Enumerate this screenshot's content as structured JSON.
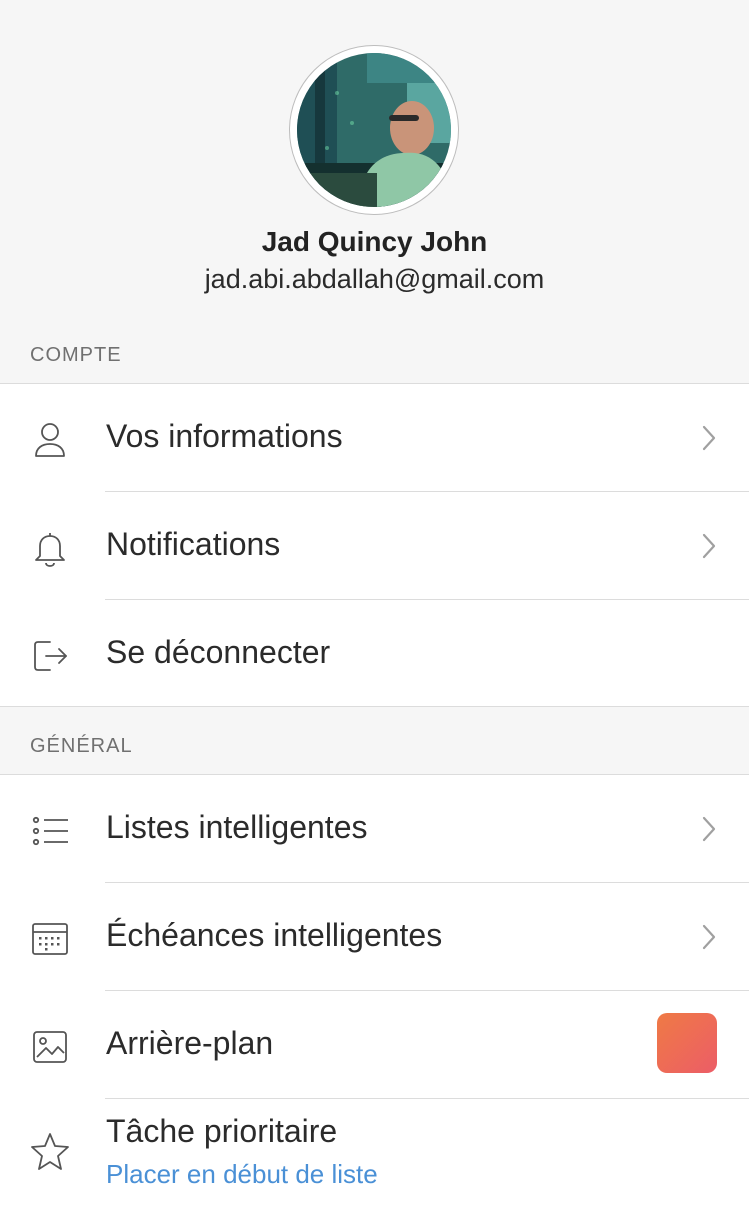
{
  "profile": {
    "name": "Jad Quincy John",
    "email": "jad.abi.abdallah@gmail.com"
  },
  "sections": {
    "compte": {
      "header": "COMPTE",
      "items": [
        {
          "label": "Vos informations",
          "icon": "user-icon",
          "chevron": true
        },
        {
          "label": "Notifications",
          "icon": "bell-icon",
          "chevron": true
        },
        {
          "label": "Se déconnecter",
          "icon": "logout-icon",
          "chevron": false
        }
      ]
    },
    "general": {
      "header": "GÉNÉRAL",
      "items": [
        {
          "label": "Listes intelligentes",
          "icon": "list-icon",
          "chevron": true
        },
        {
          "label": "Échéances intelligentes",
          "icon": "calendar-icon",
          "chevron": true
        },
        {
          "label": "Arrière-plan",
          "icon": "image-icon",
          "swatch_colors": [
            "#ef7a45",
            "#ec5d67"
          ]
        },
        {
          "label": "Tâche prioritaire",
          "sublabel": "Placer en début de liste",
          "icon": "star-icon"
        }
      ]
    }
  },
  "colors": {
    "link": "#4a90d6",
    "background_grey": "#f6f6f6",
    "divider": "#dcdcdc"
  }
}
